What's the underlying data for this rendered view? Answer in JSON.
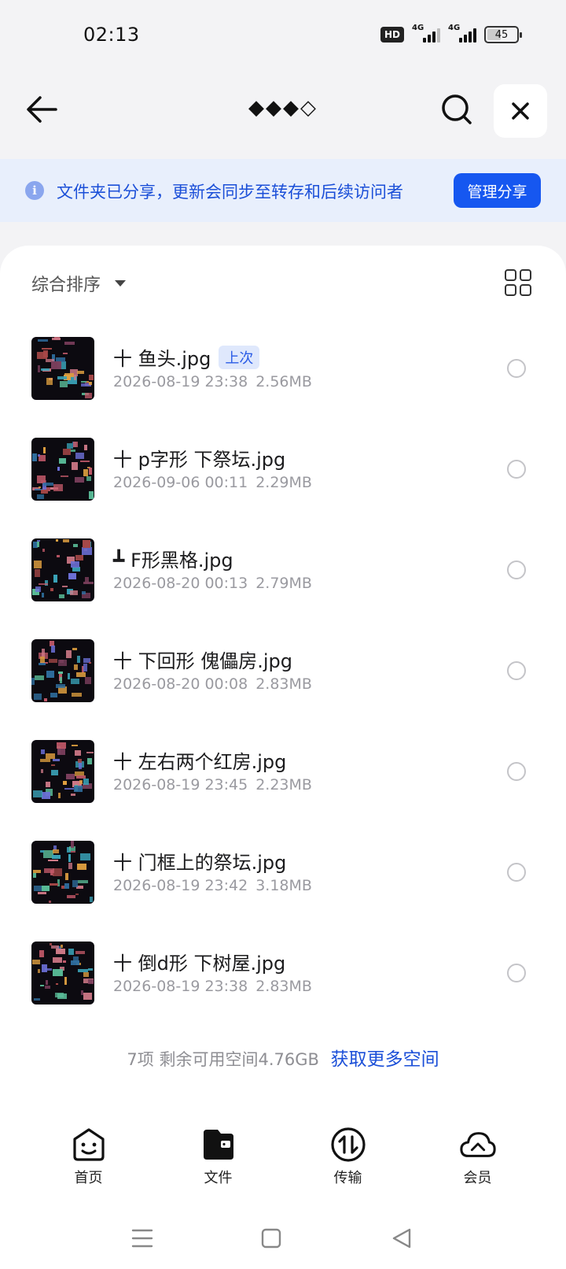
{
  "status_bar": {
    "time": "02:13",
    "hd": "HD",
    "network1": "4G",
    "network2": "4G",
    "battery": "45"
  },
  "nav": {
    "title": "◆◆◆◇",
    "back_icon": "arrow-left-icon",
    "search_icon": "search-icon",
    "close_icon": "close-icon"
  },
  "banner": {
    "text": "文件夹已分享，更新会同步至转存和后续访问者",
    "button": "管理分享",
    "accent": "#1657f0"
  },
  "toolbar": {
    "sort_label": "综合排序"
  },
  "files": [
    {
      "name": "十 鱼头.jpg",
      "tag": "上次",
      "date": "2026-08-19 23:38",
      "size": "2.56MB"
    },
    {
      "name": "十 p字形 下祭坛.jpg",
      "tag": "",
      "date": "2026-09-06 00:11",
      "size": "2.29MB"
    },
    {
      "name": "┻ F形黑格.jpg",
      "tag": "",
      "date": "2026-08-20 00:13",
      "size": "2.79MB"
    },
    {
      "name": "十 下回形 傀儡房.jpg",
      "tag": "",
      "date": "2026-08-20 00:08",
      "size": "2.83MB"
    },
    {
      "name": "十 左右两个红房.jpg",
      "tag": "",
      "date": "2026-08-19 23:45",
      "size": "2.23MB"
    },
    {
      "name": "十 门框上的祭坛.jpg",
      "tag": "",
      "date": "2026-08-19 23:42",
      "size": "3.18MB"
    },
    {
      "name": "十 倒d形 下树屋.jpg",
      "tag": "",
      "date": "2026-08-19 23:38",
      "size": "2.83MB"
    }
  ],
  "footer": {
    "count": "7项",
    "space": "剩余可用空间4.76GB",
    "link": "获取更多空间"
  },
  "tabs": [
    {
      "label": "首页",
      "icon": "home-face-icon"
    },
    {
      "label": "文件",
      "icon": "folder-icon"
    },
    {
      "label": "传输",
      "icon": "transfer-icon"
    },
    {
      "label": "会员",
      "icon": "cloud-icon"
    }
  ]
}
